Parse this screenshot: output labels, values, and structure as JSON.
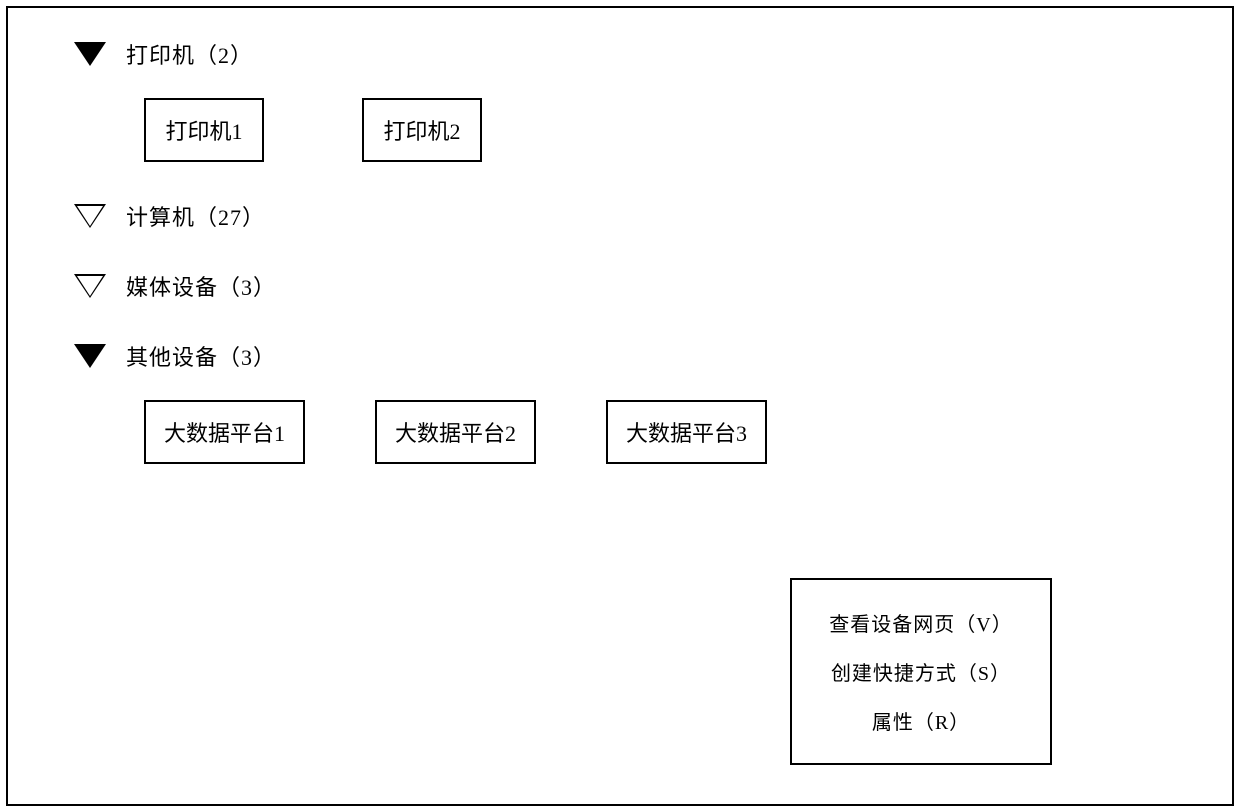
{
  "categories": [
    {
      "name": "打印机",
      "count": "2",
      "label": "打印机（2）",
      "expanded": true,
      "items": [
        "打印机1",
        "打印机2"
      ]
    },
    {
      "name": "计算机",
      "count": "27",
      "label": "计算机（27）",
      "expanded": false,
      "items": []
    },
    {
      "name": "媒体设备",
      "count": "3",
      "label": "媒体设备（3）",
      "expanded": false,
      "items": []
    },
    {
      "name": "其他设备",
      "count": "3",
      "label": "其他设备（3）",
      "expanded": true,
      "items": [
        "大数据平台1",
        "大数据平台2",
        "大数据平台3"
      ]
    }
  ],
  "context_menu": {
    "target": "大数据平台3",
    "items": [
      "查看设备网页（V）",
      "创建快捷方式（S）",
      "属性（R）"
    ]
  }
}
